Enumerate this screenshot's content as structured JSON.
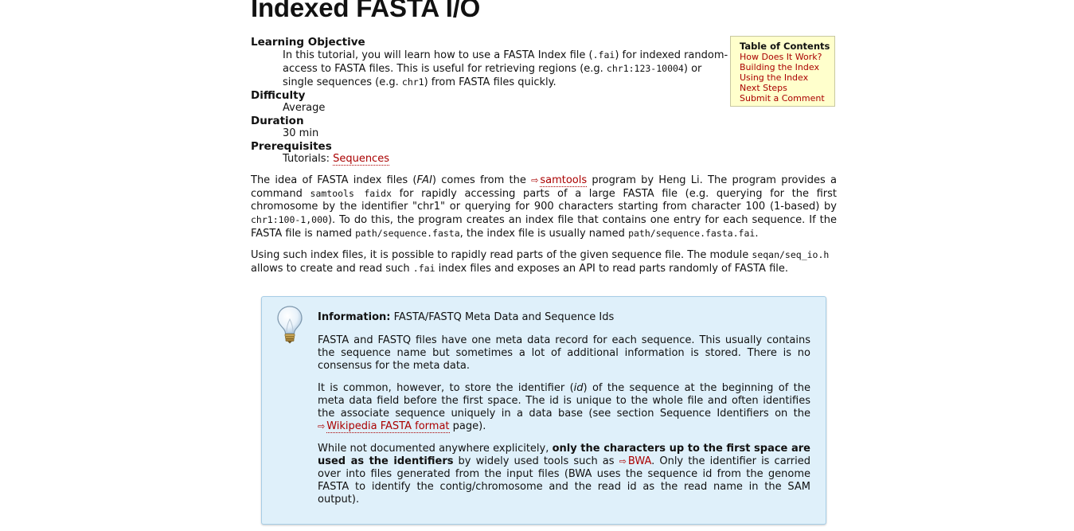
{
  "title": "Indexed FASTA I/O",
  "meta": {
    "learning_objective_label": "Learning Objective",
    "lo_part1": "In this tutorial, you will learn how to use a FASTA Index file (",
    "lo_code1": ".fai",
    "lo_part2": ") for indexed random-access to FASTA files. This is useful for retrieving regions (e.g. ",
    "lo_code2": "chr1:123-10004",
    "lo_part3": ") or single sequences (e.g. ",
    "lo_code3": "chr1",
    "lo_part4": ") from FASTA files quickly.",
    "difficulty_label": "Difficulty",
    "difficulty_value": "Average",
    "duration_label": "Duration",
    "duration_value": "30 min",
    "prerequisites_label": "Prerequisites",
    "prerequisites_prefix": "Tutorials: ",
    "prerequisites_link": "Sequences"
  },
  "toc": {
    "title": "Table of Contents",
    "items": [
      "How Does It Work?",
      "Building the Index",
      "Using the Index",
      "Next Steps",
      "Submit a Comment"
    ]
  },
  "para1": {
    "t1": "The idea of FASTA index files (",
    "fai": "FAI",
    "t2": ") comes from the ",
    "ext_icon": "⇨",
    "samtools_link": "samtools",
    "t3": " program by Heng Li. The program provides a command ",
    "code1": "samtools faidx",
    "t4": " for rapidly accessing parts of a large FASTA file (e.g. querying for the first chromosome by the identifier \"chr1\" or querying for 900 characters starting from character 100 (1-based) by ",
    "code2": "chr1:100-1,000",
    "t5": "). To do this, the program creates an index file that contains one entry for each sequence. If the FASTA file is named ",
    "code3": "path/sequence.fasta",
    "t6": ", the index file is usually named ",
    "code4": "path/sequence.fasta.fai",
    "t7": "."
  },
  "para2": {
    "t1": "Using such index files, it is possible to rapidly read parts of the given sequence file. The module ",
    "code1": "seqan/seq_io.h",
    "t2": " allows to create and read such ",
    "code2": ".fai",
    "t3": " index files and exposes an API to read parts randomly of FASTA file."
  },
  "info": {
    "icon": "lightbulb-icon",
    "head_label": "Information:",
    "head_text": " FASTA/FASTQ Meta Data and Sequence Ids",
    "p1": "FASTA and FASTQ files have one meta data record for each sequence. This usually contains the sequence name but sometimes a lot of additional information is stored. There is no consensus for the meta data.",
    "p2_t1": "It is common, however, to store the identifier (",
    "p2_id": "id",
    "p2_t2": ") of the sequence at the beginning of the meta data field before the first space. The id is unique to the whole file and often identifies the associate sequence uniquely in a data base (see section Sequence Identifiers on the ",
    "p2_ext_icon": "⇨",
    "p2_link": "Wikipedia FASTA format",
    "p2_t3": " page).",
    "p3_t1": "While not documented anywhere explicitely, ",
    "p3_bold": "only the characters up to the first space are used as the identifiers",
    "p3_t2": " by widely used tools such as ",
    "p3_ext_icon": "⇨",
    "p3_link": "BWA",
    "p3_t3": ". Only the identifier is carried over into files generated from the input files (BWA uses the sequence id from the genome FASTA to identify the contig/chromosome and the read id as the read name in the SAM output)."
  }
}
